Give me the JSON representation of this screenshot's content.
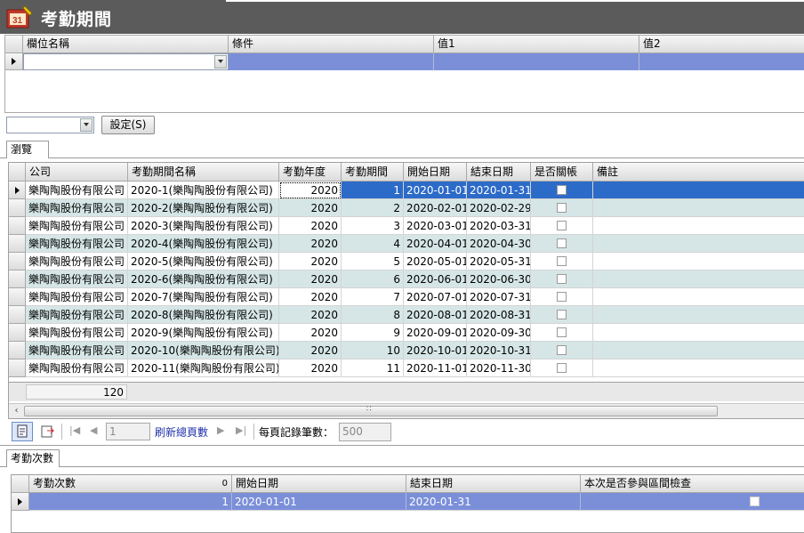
{
  "window": {
    "title": "考勤期間"
  },
  "filter": {
    "columns": [
      "欄位名稱",
      "條件",
      "值1",
      "值2"
    ],
    "row": {
      "field": "",
      "condition": "",
      "value1": "",
      "value2": ""
    }
  },
  "toolbar": {
    "preset_value": "",
    "set_button": "設定(S)"
  },
  "browse_tab": "瀏覽",
  "grid": {
    "columns": [
      "公司",
      "考勤期間名稱",
      "考勤年度",
      "考勤期間",
      "開始日期",
      "結束日期",
      "是否關帳",
      "備註"
    ],
    "rows": [
      {
        "company": "樂陶陶股份有限公司",
        "name": "2020-1(樂陶陶股份有限公司)",
        "year": "2020",
        "period": "1",
        "start": "2020-01-01",
        "end": "2020-01-31",
        "closed": false,
        "note": ""
      },
      {
        "company": "樂陶陶股份有限公司",
        "name": "2020-2(樂陶陶股份有限公司)",
        "year": "2020",
        "period": "2",
        "start": "2020-02-01",
        "end": "2020-02-29",
        "closed": false,
        "note": ""
      },
      {
        "company": "樂陶陶股份有限公司",
        "name": "2020-3(樂陶陶股份有限公司)",
        "year": "2020",
        "period": "3",
        "start": "2020-03-01",
        "end": "2020-03-31",
        "closed": false,
        "note": ""
      },
      {
        "company": "樂陶陶股份有限公司",
        "name": "2020-4(樂陶陶股份有限公司)",
        "year": "2020",
        "period": "4",
        "start": "2020-04-01",
        "end": "2020-04-30",
        "closed": false,
        "note": ""
      },
      {
        "company": "樂陶陶股份有限公司",
        "name": "2020-5(樂陶陶股份有限公司)",
        "year": "2020",
        "period": "5",
        "start": "2020-05-01",
        "end": "2020-05-31",
        "closed": false,
        "note": ""
      },
      {
        "company": "樂陶陶股份有限公司",
        "name": "2020-6(樂陶陶股份有限公司)",
        "year": "2020",
        "period": "6",
        "start": "2020-06-01",
        "end": "2020-06-30",
        "closed": false,
        "note": ""
      },
      {
        "company": "樂陶陶股份有限公司",
        "name": "2020-7(樂陶陶股份有限公司)",
        "year": "2020",
        "period": "7",
        "start": "2020-07-01",
        "end": "2020-07-31",
        "closed": false,
        "note": ""
      },
      {
        "company": "樂陶陶股份有限公司",
        "name": "2020-8(樂陶陶股份有限公司)",
        "year": "2020",
        "period": "8",
        "start": "2020-08-01",
        "end": "2020-08-31",
        "closed": false,
        "note": ""
      },
      {
        "company": "樂陶陶股份有限公司",
        "name": "2020-9(樂陶陶股份有限公司)",
        "year": "2020",
        "period": "9",
        "start": "2020-09-01",
        "end": "2020-09-30",
        "closed": false,
        "note": ""
      },
      {
        "company": "樂陶陶股份有限公司",
        "name": "2020-10(樂陶陶股份有限公司)",
        "year": "2020",
        "period": "10",
        "start": "2020-10-01",
        "end": "2020-10-31",
        "closed": false,
        "note": ""
      },
      {
        "company": "樂陶陶股份有限公司",
        "name": "2020-11(樂陶陶股份有限公司)",
        "year": "2020",
        "period": "11",
        "start": "2020-11-01",
        "end": "2020-11-30",
        "closed": false,
        "note": ""
      }
    ],
    "footer_count": "120",
    "selected_row": 0
  },
  "pager": {
    "page_value": "1",
    "refresh_label": "刷新總頁數",
    "per_page_label": "每頁記錄筆數：",
    "per_page_value": "500"
  },
  "detail": {
    "tab": "考勤次數",
    "columns": [
      "考勤次數",
      "開始日期",
      "結束日期",
      "本次是否參與區間檢查"
    ],
    "sort_indicator": "0",
    "rows": [
      {
        "count": "1",
        "start": "2020-01-01",
        "end": "2020-01-31",
        "checked": false
      }
    ]
  },
  "colors": {
    "titlebar": "#5b5b5b",
    "selected": "#2d6bc9",
    "detail_selected": "#7b8fd9",
    "alt_row": "#d6e6e6",
    "filter_row": "#7b8fd9"
  }
}
